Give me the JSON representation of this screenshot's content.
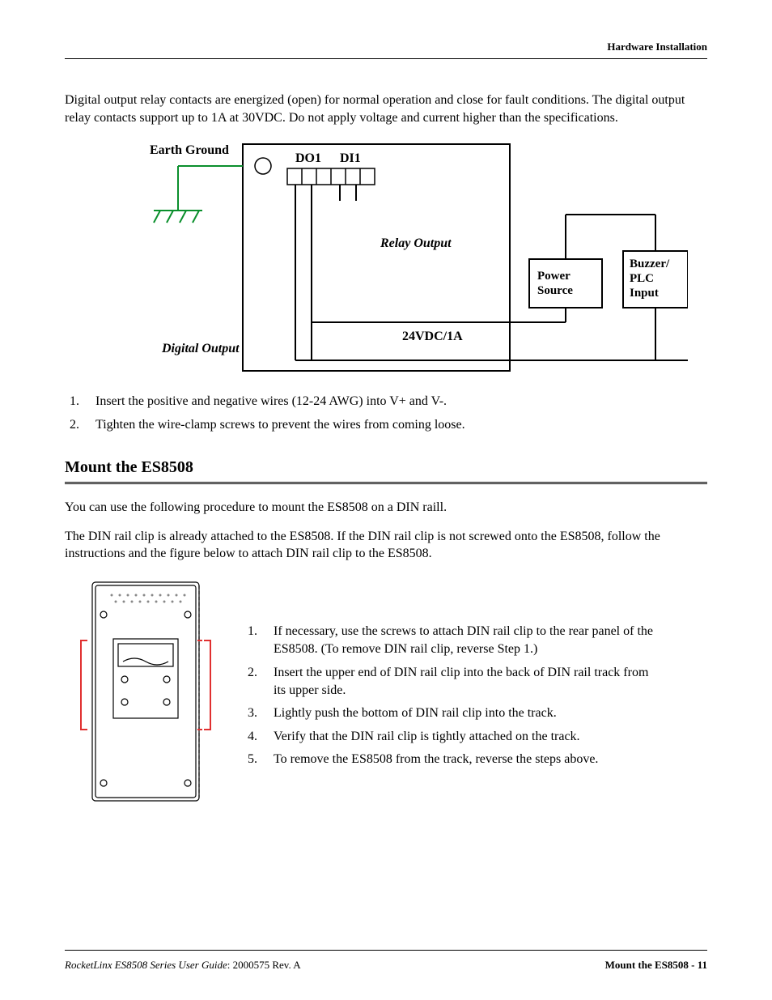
{
  "header": {
    "right": "Hardware Installation"
  },
  "intro": {
    "para": "Digital output relay contacts are energized (open) for normal operation and close for fault conditions. The digital output relay contacts support up to 1A at 30VDC. Do not apply voltage and current higher than the specifications."
  },
  "diagram1": {
    "earth_ground": "Earth Ground",
    "do1": "DO1",
    "di1": "DI1",
    "relay_output": "Relay Output",
    "power_source": "Power\nSource",
    "buzzer_plc_input": "Buzzer/\nPLC\nInput",
    "volt_spec": "24VDC/1A",
    "digital_output": "Digital Output"
  },
  "steps_first": [
    "Insert the positive and negative wires (12-24 AWG) into V+ and V-.",
    "Tighten the wire-clamp screws to prevent the wires from coming loose."
  ],
  "section2": {
    "title": "Mount the ES8508",
    "para1": "You can use the following procedure to mount the ES8508 on a DIN raill.",
    "para2": "The DIN rail clip is already attached to the ES8508. If the DIN rail clip is not screwed onto the ES8508, follow the instructions and the figure below to attach DIN rail clip to the ES8508."
  },
  "steps_mount": [
    "If necessary, use the screws to attach DIN rail clip to the rear panel of the ES8508. (To remove DIN rail clip, reverse Step 1.)",
    "Insert the upper end of DIN rail clip into the back of DIN rail track from its upper side.",
    "Lightly push the bottom of DIN rail clip into the track.",
    "Verify that the DIN rail clip is tightly attached on the track.",
    "To remove the ES8508 from the track, reverse the steps above."
  ],
  "footer": {
    "left_italic": "RocketLinx ES8508 Series  User Guide",
    "left_rest": ": 2000575 Rev. A",
    "right": "Mount the ES8508 - 11"
  }
}
